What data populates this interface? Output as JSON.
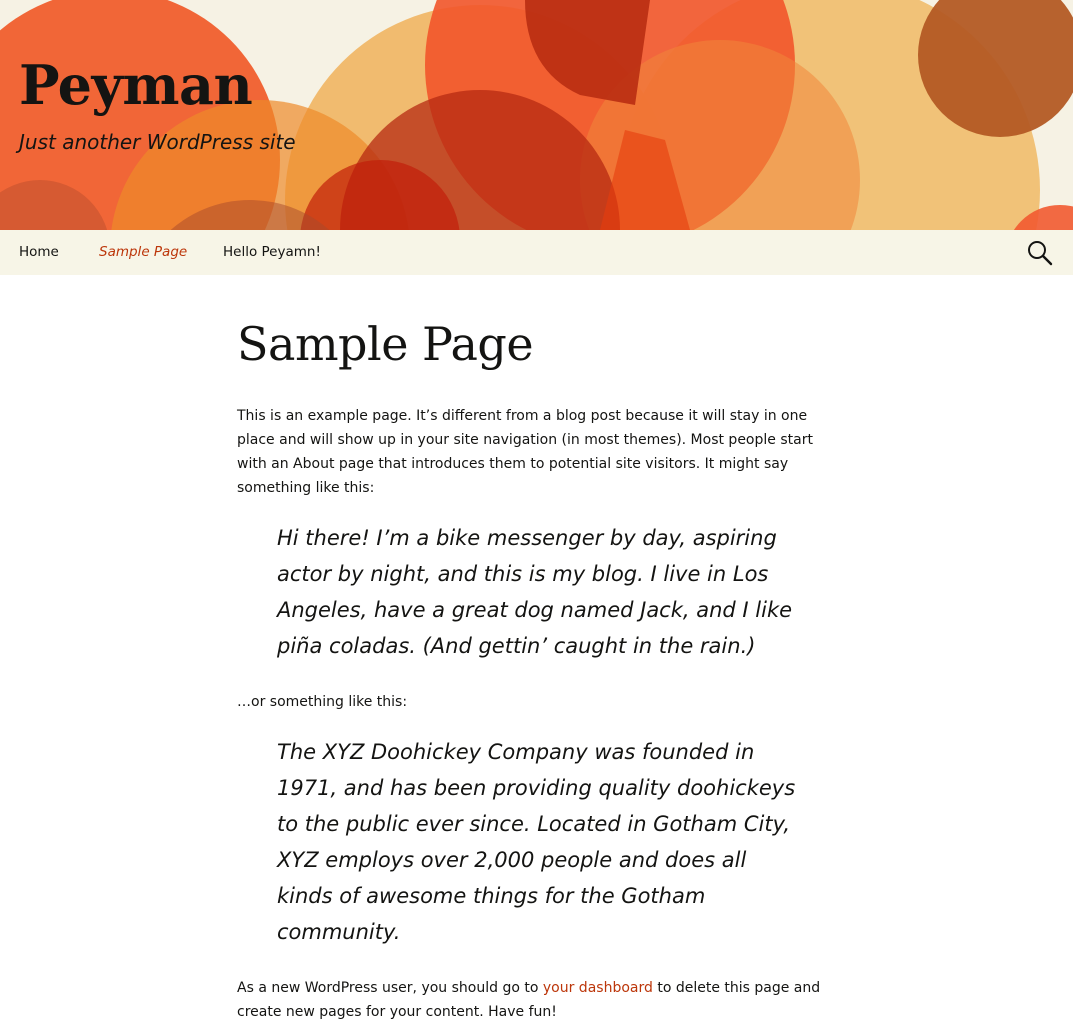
{
  "site": {
    "title": "Peyman",
    "description": "Just another WordPress site"
  },
  "nav": {
    "items": [
      {
        "label": "Home"
      },
      {
        "label": "Sample Page"
      },
      {
        "label": "Hello Peyamn!"
      }
    ],
    "search_icon": "search-icon"
  },
  "page": {
    "title": "Sample Page",
    "intro": "This is an example page. It’s different from a blog post because it will stay in one place and will show up in your site navigation (in most themes). Most people start with an About page that introduces them to potential site visitors. It might say something like this:",
    "quote1": "Hi there! I’m a bike messenger by day, aspiring actor by night, and this is my blog. I live in Los Angeles, have a great dog named Jack, and I like piña coladas. (And gettin’ caught in the rain.)",
    "middle": "…or something like this:",
    "quote2": "The XYZ Doohickey Company was founded in 1971, and has been providing quality doohickeys to the public ever since. Located in Gotham City, XYZ employs over 2,000 people and does all kinds of awesome things for the Gotham community.",
    "outro_before": "As a new WordPress user, you should go to ",
    "outro_link": "your dashboard",
    "outro_after": " to delete this page and create new pages for your content. Have fun!"
  },
  "colors": {
    "accent": "#bc360a",
    "nav_bg": "#f7f5e7",
    "header_bg": "#f6f2e4",
    "text": "#141412"
  }
}
